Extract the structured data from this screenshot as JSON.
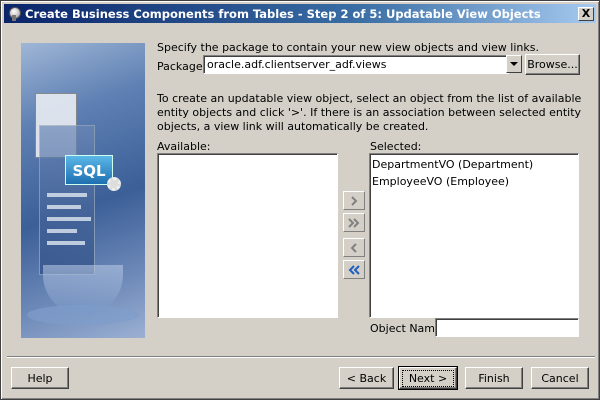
{
  "window": {
    "title": "Create Business Components from Tables - Step 2 of 5: Updatable View Objects",
    "close_label": "X"
  },
  "instructions": {
    "package_prompt": "Specify the package to contain your new view objects and view links.",
    "create_prompt": "To create an updatable view object, select an object from the list of available entity objects and click '>'.  If there is an association between selected entity objects, a view link will automatically be created."
  },
  "package": {
    "label": "Package:",
    "value": "oracle.adf.clientserver_adf.views",
    "browse_label": "Browse..."
  },
  "available": {
    "label": "Available:",
    "items": []
  },
  "selected": {
    "label": "Selected:",
    "items": [
      "DepartmentVO (Department)",
      "EmployeeVO (Employee)"
    ]
  },
  "shuttle": {
    "add_icon": "chevron-right-icon",
    "add_all_icon": "double-chevron-right-icon",
    "remove_icon": "chevron-left-icon",
    "remove_all_icon": "double-chevron-left-icon"
  },
  "object_name": {
    "label": "Object Name:",
    "value": ""
  },
  "footer": {
    "help_label": "Help",
    "back_label": "< Back",
    "next_label": "Next >",
    "finish_label": "Finish",
    "cancel_label": "Cancel"
  },
  "sidebar_image": {
    "badge_text": "SQL"
  },
  "colors": {
    "titlebar_start": "#0a246a",
    "titlebar_end": "#a6caf0",
    "dialog_bg": "#d4d0c8",
    "remove_all_icon_color": "#1f5fbf"
  }
}
